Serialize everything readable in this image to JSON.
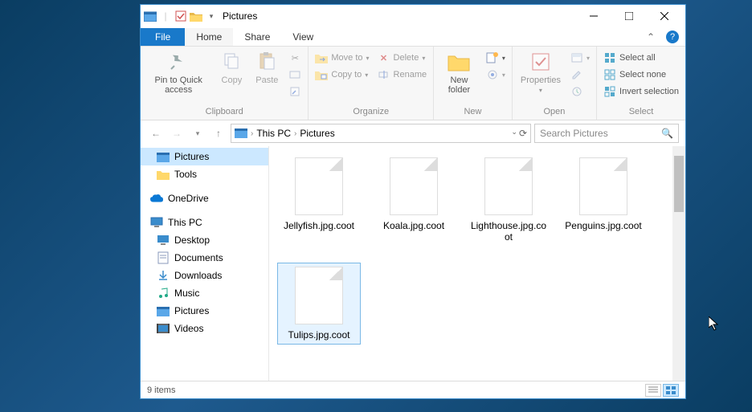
{
  "window": {
    "title": "Pictures"
  },
  "tabs": {
    "file": "File",
    "home": "Home",
    "share": "Share",
    "view": "View"
  },
  "ribbon": {
    "clipboard": {
      "label": "Clipboard",
      "pin": "Pin to Quick access",
      "copy": "Copy",
      "paste": "Paste"
    },
    "organize": {
      "label": "Organize",
      "move": "Move to",
      "copy": "Copy to",
      "delete": "Delete",
      "rename": "Rename"
    },
    "new": {
      "label": "New",
      "newfolder": "New folder"
    },
    "open": {
      "label": "Open",
      "properties": "Properties"
    },
    "select": {
      "label": "Select",
      "all": "Select all",
      "none": "Select none",
      "invert": "Invert selection"
    }
  },
  "address": {
    "root": "This PC",
    "current": "Pictures"
  },
  "search": {
    "placeholder": "Search Pictures"
  },
  "sidebar": {
    "pictures_qa": "Pictures",
    "tools": "Tools",
    "onedrive": "OneDrive",
    "thispc": "This PC",
    "desktop": "Desktop",
    "documents": "Documents",
    "downloads": "Downloads",
    "music": "Music",
    "pictures": "Pictures",
    "videos": "Videos"
  },
  "files": [
    {
      "name": "Jellyfish.jpg.coot",
      "selected": false
    },
    {
      "name": "Koala.jpg.coot",
      "selected": false
    },
    {
      "name": "Lighthouse.jpg.coot",
      "selected": false
    },
    {
      "name": "Penguins.jpg.coot",
      "selected": false
    },
    {
      "name": "Tulips.jpg.coot",
      "selected": true
    }
  ],
  "status": {
    "items": "9 items"
  }
}
